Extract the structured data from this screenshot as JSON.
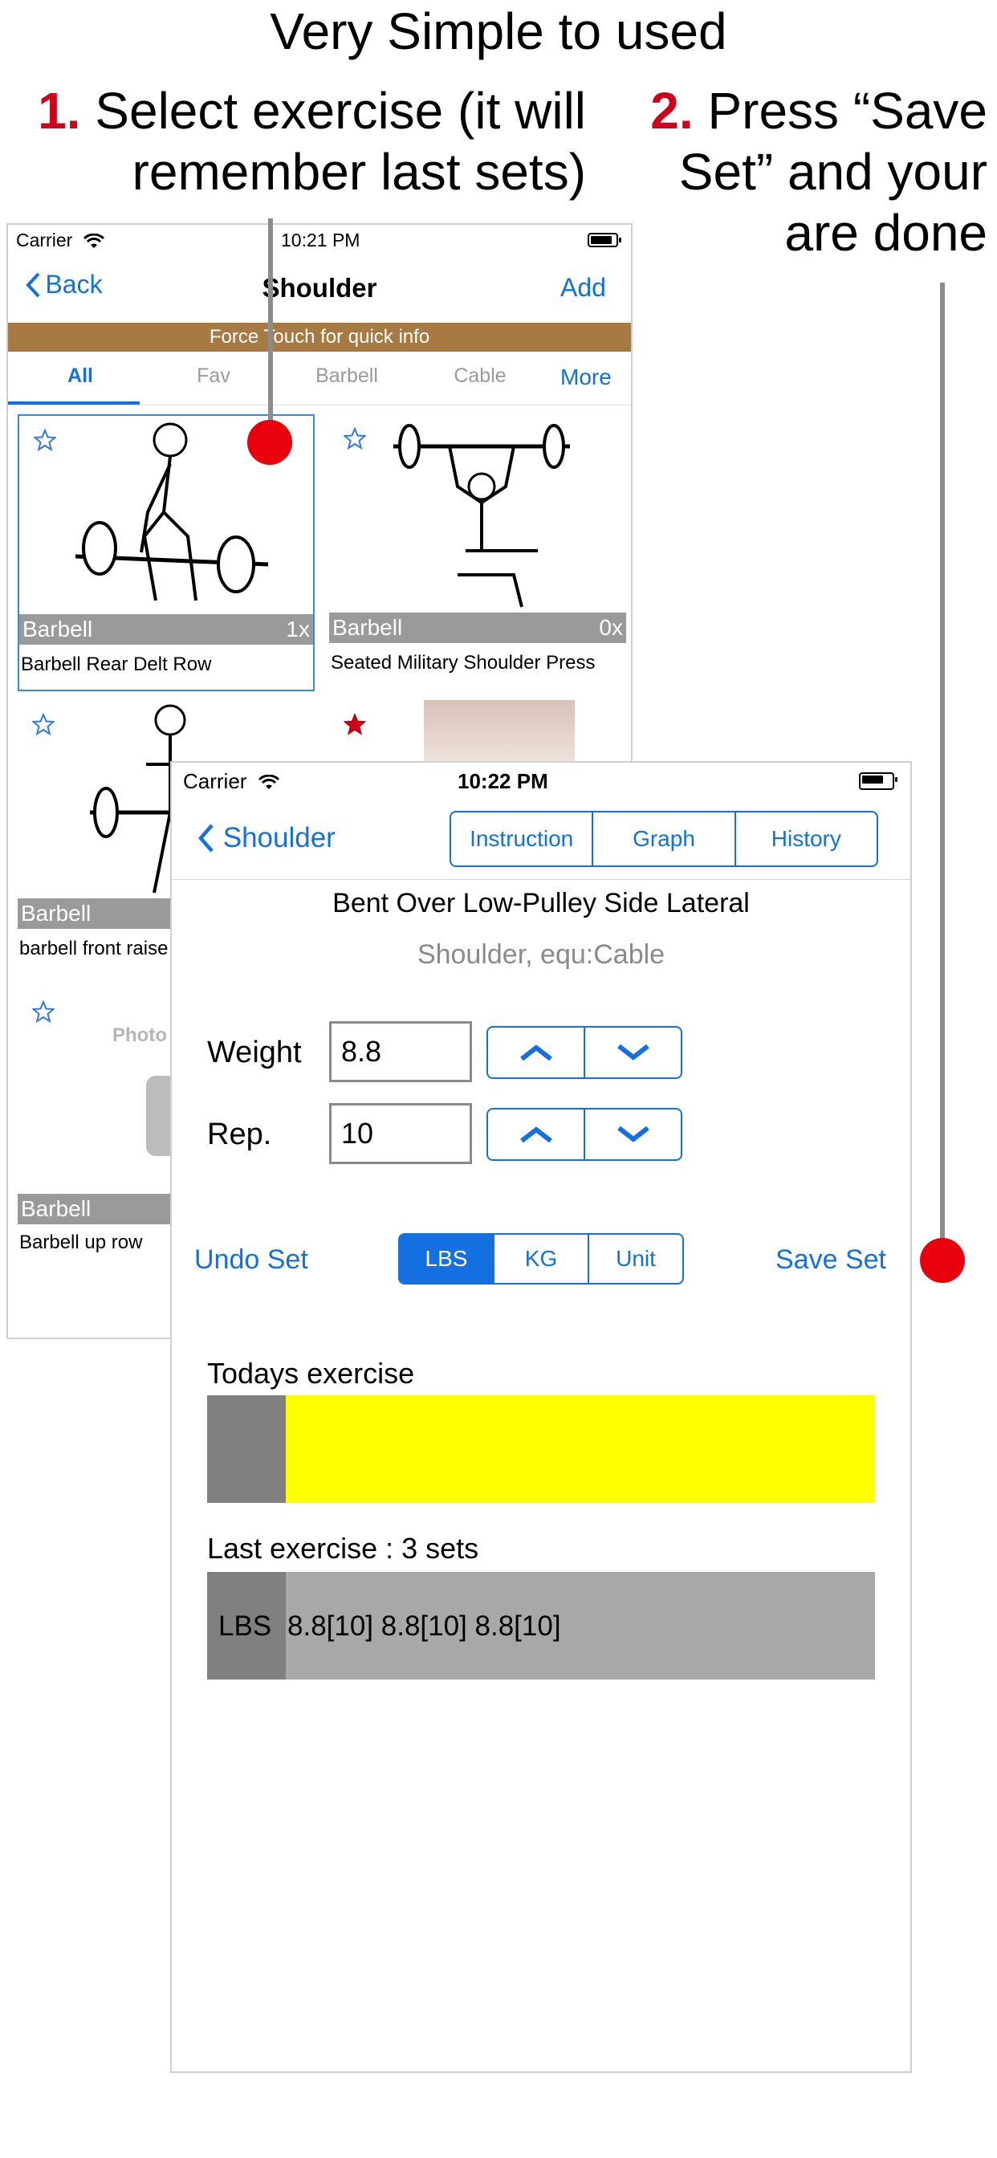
{
  "headline": "Very Simple to used",
  "steps": [
    {
      "number": "1.",
      "text": "Select exercise (it will remember last  sets)"
    },
    {
      "number": "2.",
      "text": "Press “Save Set” and your are done"
    }
  ],
  "list_screen": {
    "status": {
      "carrier": "Carrier",
      "time": "10:21 PM"
    },
    "nav": {
      "back_label": "Back",
      "title": "Shoulder",
      "add_label": "Add"
    },
    "banner": "Force Touch  for quick info",
    "tabs": [
      "All",
      "Fav",
      "Barbell",
      "Cable"
    ],
    "active_tab": "All",
    "more_label": "More",
    "tiles": [
      {
        "category": "Barbell",
        "count": "1x",
        "caption": "Barbell Rear Delt Row",
        "favorite": false,
        "selected": true
      },
      {
        "category": "Barbell",
        "count": "0x",
        "caption": "Seated Military Shoulder Press",
        "favorite": false,
        "selected": false
      },
      {
        "category": "Barbell",
        "count": "",
        "caption": "barbell front raise",
        "favorite": false,
        "selected": false
      },
      {
        "category": "",
        "count": "",
        "caption": "",
        "favorite": true,
        "selected": false
      },
      {
        "category": "Barbell",
        "count": "",
        "caption": "Barbell up row",
        "favorite": false,
        "selected": false,
        "placeholder_text": "Photo N"
      }
    ]
  },
  "detail_screen": {
    "status": {
      "carrier": "Carrier",
      "time": "10:22 PM"
    },
    "nav": {
      "back_label": "Shoulder"
    },
    "segments": [
      "Instruction",
      "Graph",
      "History"
    ],
    "exercise_name": "Bent Over Low-Pulley Side Lateral",
    "exercise_sub": "Shoulder, equ:Cable",
    "weight": {
      "label": "Weight",
      "value": "8.8"
    },
    "reps": {
      "label": "Rep.",
      "value": "10"
    },
    "undo_label": "Undo Set",
    "unit_options": [
      "LBS",
      "KG",
      "Unit"
    ],
    "unit_selected": "LBS",
    "save_label": "Save Set",
    "todays_label": "Todays exercise",
    "last_label": "Last exercise : 3 sets",
    "last_unit": "LBS",
    "last_sets": "8.8[10] 8.8[10] 8.8[10]"
  },
  "colors": {
    "accent": "#1470e0",
    "step_number": "#d0021b",
    "marker": "#e8000d",
    "banner": "#a87a43",
    "progress": "#ffff00"
  }
}
